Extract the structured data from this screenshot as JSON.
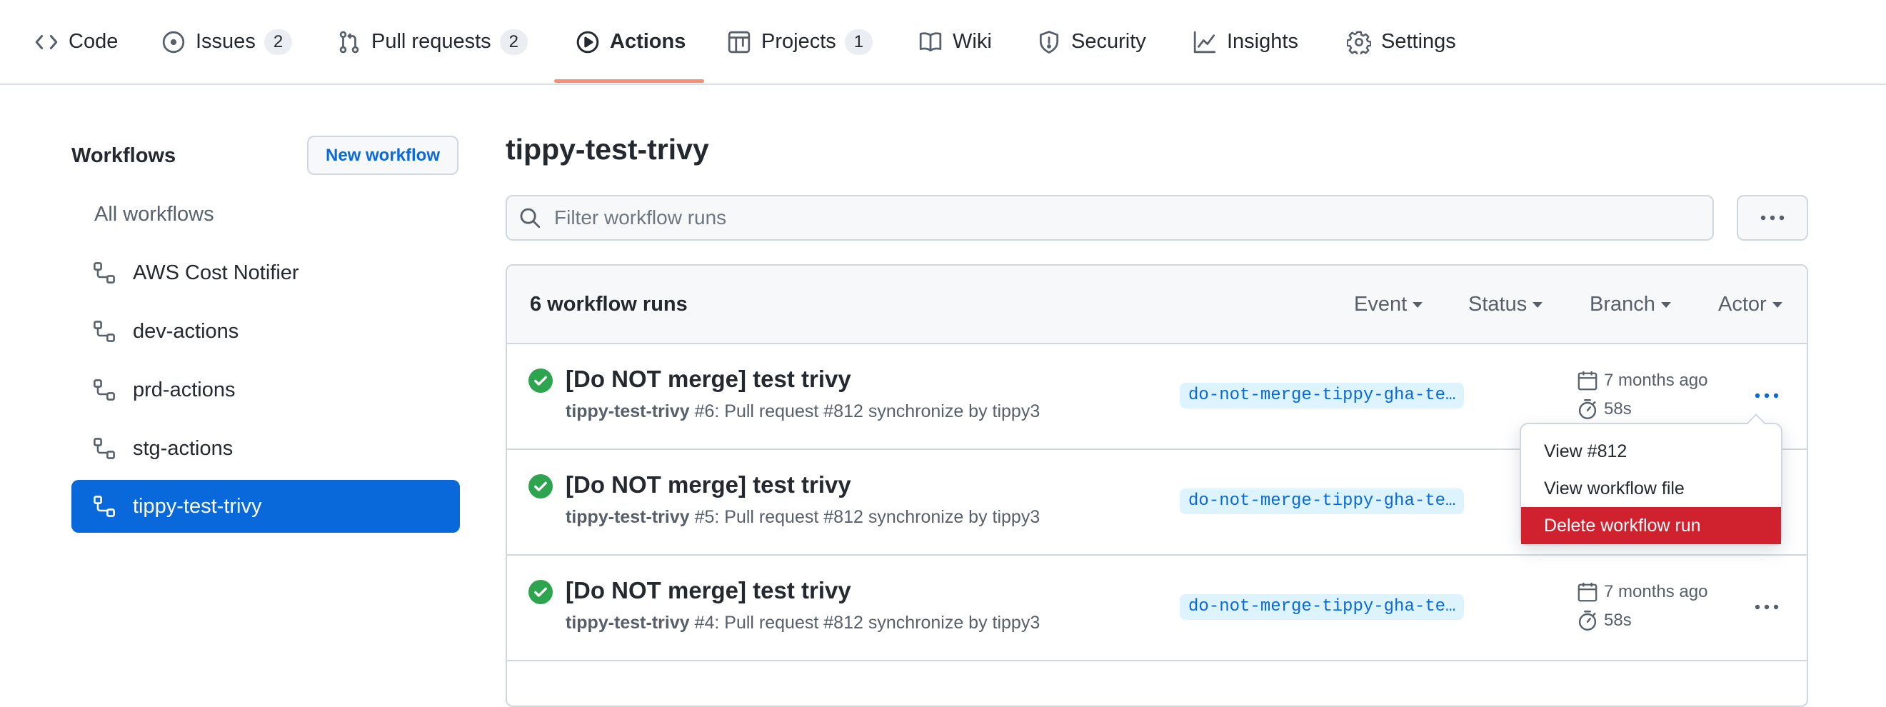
{
  "nav": {
    "tabs": [
      {
        "label": "Code",
        "icon": "code-icon",
        "count": null
      },
      {
        "label": "Issues",
        "icon": "issue-opened-icon",
        "count": "2"
      },
      {
        "label": "Pull requests",
        "icon": "git-pull-request-icon",
        "count": "2"
      },
      {
        "label": "Actions",
        "icon": "play-icon",
        "count": null,
        "active": true
      },
      {
        "label": "Projects",
        "icon": "table-icon",
        "count": "1"
      },
      {
        "label": "Wiki",
        "icon": "book-icon",
        "count": null
      },
      {
        "label": "Security",
        "icon": "shield-icon",
        "count": null
      },
      {
        "label": "Insights",
        "icon": "graph-icon",
        "count": null
      },
      {
        "label": "Settings",
        "icon": "gear-icon",
        "count": null
      }
    ],
    "active_underline_color": "#fd8c73"
  },
  "sidebar": {
    "title": "Workflows",
    "new_button": "New workflow",
    "all_label": "All workflows",
    "items": [
      {
        "label": "AWS Cost Notifier",
        "icon": "workflow-icon"
      },
      {
        "label": "dev-actions",
        "icon": "workflow-icon"
      },
      {
        "label": "prd-actions",
        "icon": "workflow-icon"
      },
      {
        "label": "stg-actions",
        "icon": "workflow-icon"
      },
      {
        "label": "tippy-test-trivy",
        "icon": "workflow-icon",
        "selected": true
      }
    ],
    "selected_color": "#0969da"
  },
  "main": {
    "title": "tippy-test-trivy",
    "filter_placeholder": "Filter workflow runs",
    "runs_count": "6 workflow runs",
    "filters": [
      "Event",
      "Status",
      "Branch",
      "Actor"
    ],
    "runs": [
      {
        "title": "[Do NOT merge] test trivy",
        "workflow": "tippy-test-trivy",
        "detail": "#6: Pull request #812 synchronize by tippy3",
        "branch": "do-not-merge-tippy-gha-te…",
        "date": "7 months ago",
        "duration": "58s",
        "status": "success"
      },
      {
        "title": "[Do NOT merge] test trivy",
        "workflow": "tippy-test-trivy",
        "detail": "#5: Pull request #812 synchronize by tippy3",
        "branch": "do-not-merge-tippy-gha-te…",
        "date": "",
        "duration": "",
        "status": "success"
      },
      {
        "title": "[Do NOT merge] test trivy",
        "workflow": "tippy-test-trivy",
        "detail": "#4: Pull request #812 synchronize by tippy3",
        "branch": "do-not-merge-tippy-gha-te…",
        "date": "7 months ago",
        "duration": "58s",
        "status": "success"
      }
    ],
    "success_color": "#2da44e"
  },
  "context_menu": {
    "items": [
      "View #812",
      "View workflow file",
      "Delete workflow run"
    ],
    "danger_color": "#cf222e"
  }
}
